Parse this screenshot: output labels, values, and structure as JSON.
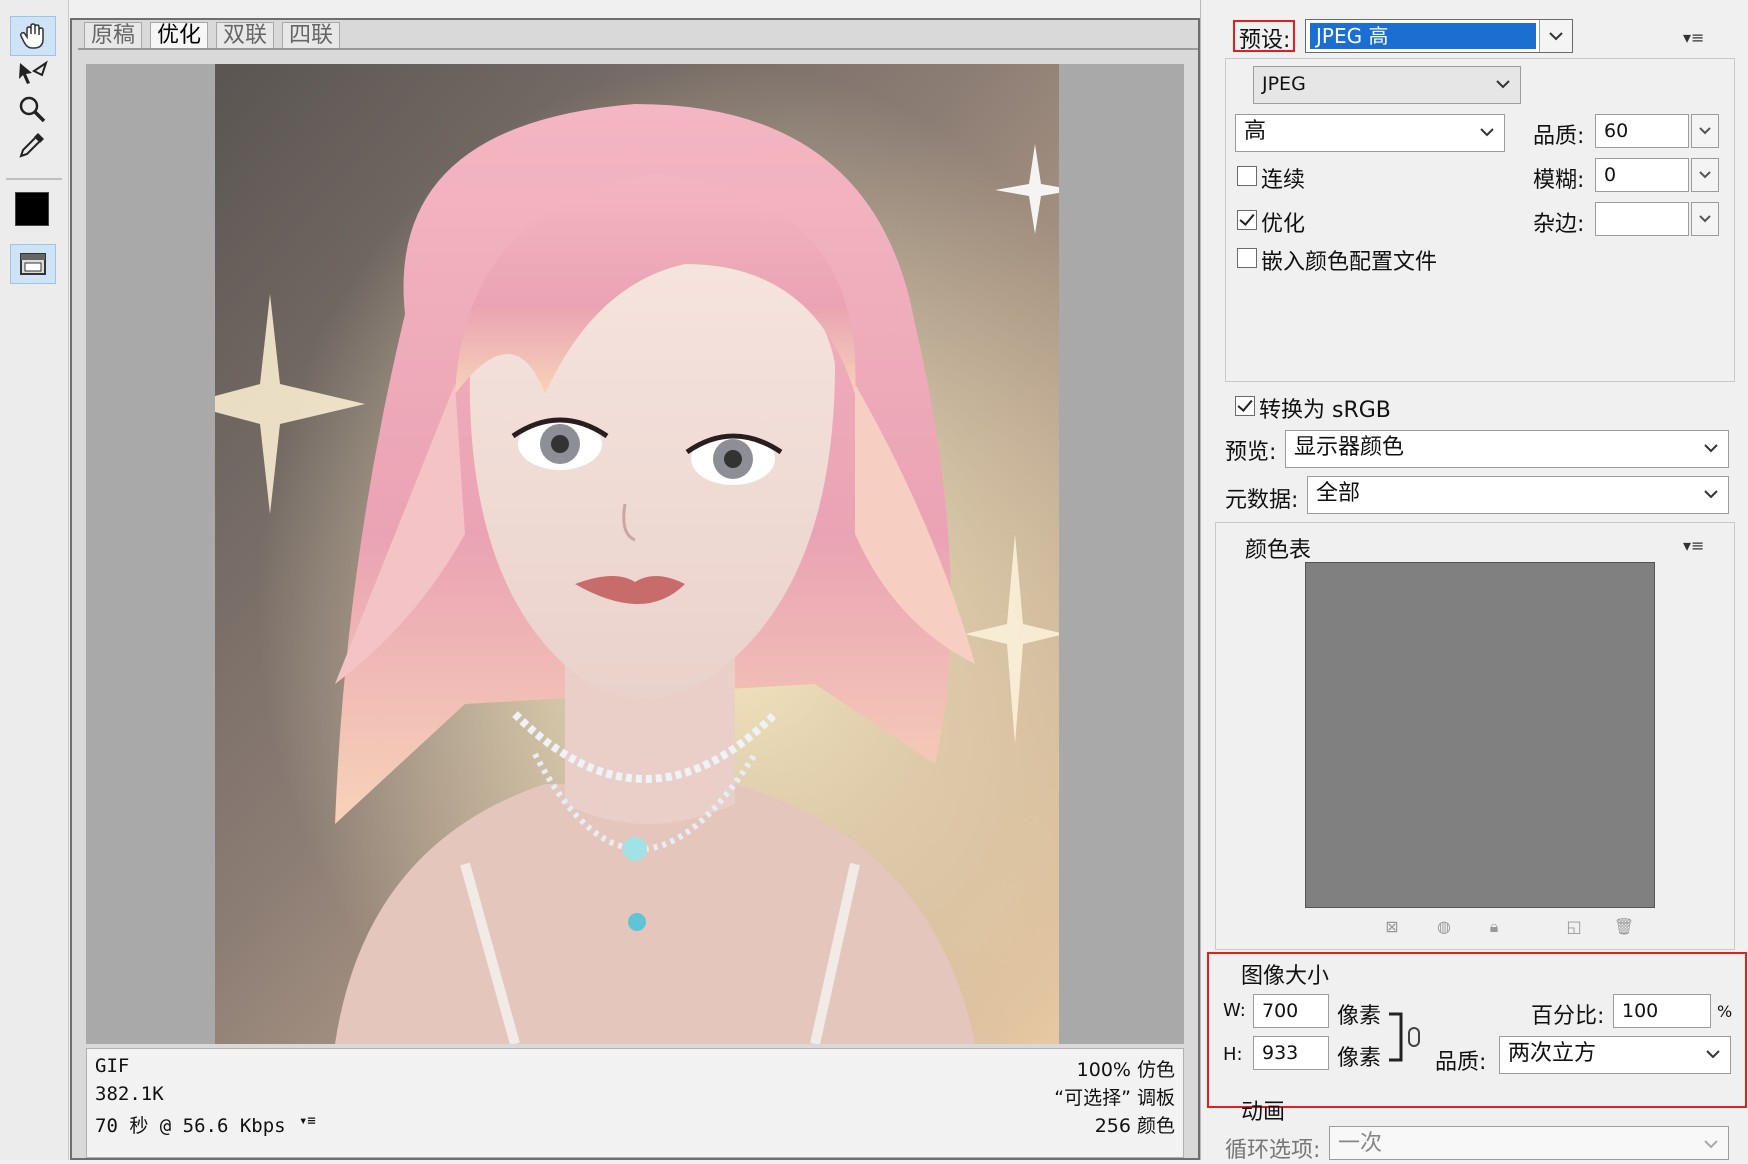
{
  "tools": [
    {
      "name": "hand-icon"
    },
    {
      "name": "slice-select-icon"
    },
    {
      "name": "zoom-icon"
    },
    {
      "name": "eyedropper-icon"
    },
    {
      "name": "eyedropper-color-swatch",
      "color": "#000000"
    },
    {
      "name": "toggle-slices-icon"
    }
  ],
  "tabs": [
    {
      "label": "原稿",
      "active": false
    },
    {
      "label": "优化",
      "active": true
    },
    {
      "label": "双联",
      "active": false
    },
    {
      "label": "四联",
      "active": false
    }
  ],
  "info": {
    "format": "GIF",
    "size": "382.1K",
    "time": "70 秒 @ 56.6 Kbps",
    "dither": "100% 仿色",
    "palette": "“可选择” 调板",
    "colors": "256 颜色"
  },
  "settings": {
    "preset_label": "预设:",
    "preset_value": "JPEG 高",
    "format_value": "JPEG",
    "quality_level": "高",
    "quality_label": "品质:",
    "quality_value": "60",
    "progressive_label": "连续",
    "progressive_checked": false,
    "blur_label": "模糊:",
    "blur_value": "0",
    "optimized_label": "优化",
    "optimized_checked": true,
    "matte_label": "杂边:",
    "matte_value": "",
    "embed_profile_label": "嵌入颜色配置文件",
    "embed_profile_checked": false,
    "convert_srgb_label": "转换为 sRGB",
    "convert_srgb_checked": true,
    "preview_label": "预览:",
    "preview_value": "显示器颜色",
    "metadata_label": "元数据:",
    "metadata_value": "全部"
  },
  "color_table": {
    "title": "颜色表",
    "bg_color": "#808080"
  },
  "image_size": {
    "title": "图像大小",
    "w_label": "W:",
    "w_value": "700",
    "h_label": "H:",
    "h_value": "933",
    "unit": "像素",
    "percent_label": "百分比:",
    "percent_value": "100",
    "percent_sign": "%",
    "quality_label": "品质:",
    "quality_value": "两次立方"
  },
  "animation": {
    "title": "动画",
    "loop_label": "循环选项:",
    "loop_value": "一次"
  },
  "colors": {
    "highlight": "#1a6fd1",
    "red_box": "#e02020"
  }
}
